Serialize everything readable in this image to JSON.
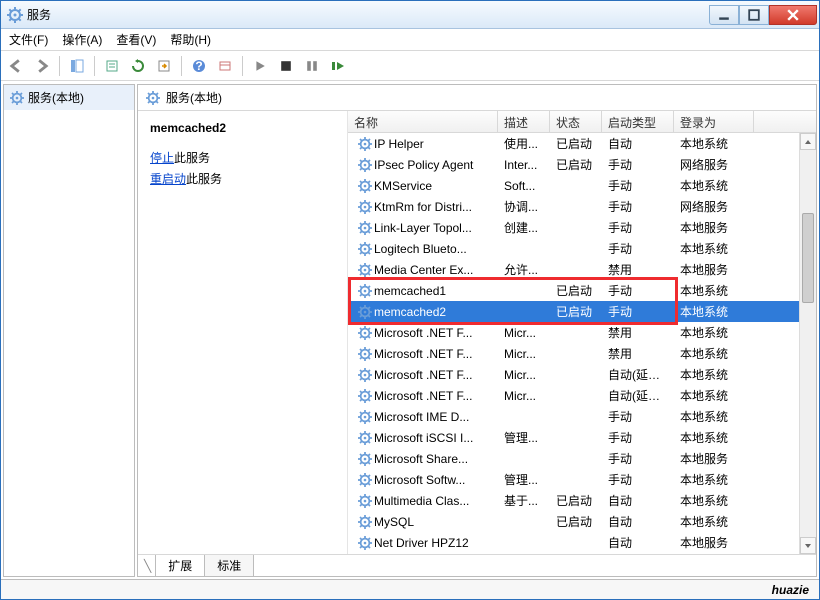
{
  "window": {
    "title": "服务"
  },
  "menu": {
    "file": "文件(F)",
    "action": "操作(A)",
    "view": "查看(V)",
    "help": "帮助(H)"
  },
  "left": {
    "label": "服务(本地)"
  },
  "right_header": {
    "label": "服务(本地)"
  },
  "detail": {
    "selected_name": "memcached2",
    "stop_link": "停止",
    "stop_suffix": "此服务",
    "restart_link": "重启动",
    "restart_suffix": "此服务"
  },
  "columns": {
    "name": "名称",
    "desc": "描述",
    "status": "状态",
    "start": "启动类型",
    "logon": "登录为"
  },
  "services": [
    {
      "name": "IP Helper",
      "desc": "使用...",
      "status": "已启动",
      "start": "自动",
      "logon": "本地系统"
    },
    {
      "name": "IPsec Policy Agent",
      "desc": "Inter...",
      "status": "已启动",
      "start": "手动",
      "logon": "网络服务"
    },
    {
      "name": "KMService",
      "desc": "Soft...",
      "status": "",
      "start": "手动",
      "logon": "本地系统"
    },
    {
      "name": "KtmRm for Distri...",
      "desc": "协调...",
      "status": "",
      "start": "手动",
      "logon": "网络服务"
    },
    {
      "name": "Link-Layer Topol...",
      "desc": "创建...",
      "status": "",
      "start": "手动",
      "logon": "本地服务"
    },
    {
      "name": "Logitech Blueto...",
      "desc": "",
      "status": "",
      "start": "手动",
      "logon": "本地系统"
    },
    {
      "name": "Media Center Ex...",
      "desc": "允许...",
      "status": "",
      "start": "禁用",
      "logon": "本地服务"
    },
    {
      "name": "memcached1",
      "desc": "",
      "status": "已启动",
      "start": "手动",
      "logon": "本地系统",
      "highlight": true
    },
    {
      "name": "memcached2",
      "desc": "",
      "status": "已启动",
      "start": "手动",
      "logon": "本地系统",
      "highlight": true,
      "selected": true
    },
    {
      "name": "Microsoft .NET F...",
      "desc": "Micr...",
      "status": "",
      "start": "禁用",
      "logon": "本地系统"
    },
    {
      "name": "Microsoft .NET F...",
      "desc": "Micr...",
      "status": "",
      "start": "禁用",
      "logon": "本地系统"
    },
    {
      "name": "Microsoft .NET F...",
      "desc": "Micr...",
      "status": "",
      "start": "自动(延迟...",
      "logon": "本地系统"
    },
    {
      "name": "Microsoft .NET F...",
      "desc": "Micr...",
      "status": "",
      "start": "自动(延迟...",
      "logon": "本地系统"
    },
    {
      "name": "Microsoft IME D...",
      "desc": "",
      "status": "",
      "start": "手动",
      "logon": "本地系统"
    },
    {
      "name": "Microsoft iSCSI I...",
      "desc": "管理...",
      "status": "",
      "start": "手动",
      "logon": "本地系统"
    },
    {
      "name": "Microsoft Share...",
      "desc": "",
      "status": "",
      "start": "手动",
      "logon": "本地服务"
    },
    {
      "name": "Microsoft Softw...",
      "desc": "管理...",
      "status": "",
      "start": "手动",
      "logon": "本地系统"
    },
    {
      "name": "Multimedia Clas...",
      "desc": "基于...",
      "status": "已启动",
      "start": "自动",
      "logon": "本地系统"
    },
    {
      "name": "MySQL",
      "desc": "",
      "status": "已启动",
      "start": "自动",
      "logon": "本地系统"
    },
    {
      "name": "Net Driver HPZ12",
      "desc": "",
      "status": "",
      "start": "自动",
      "logon": "本地服务"
    }
  ],
  "tabs": {
    "extended": "扩展",
    "standard": "标准"
  },
  "watermark": "huazie"
}
